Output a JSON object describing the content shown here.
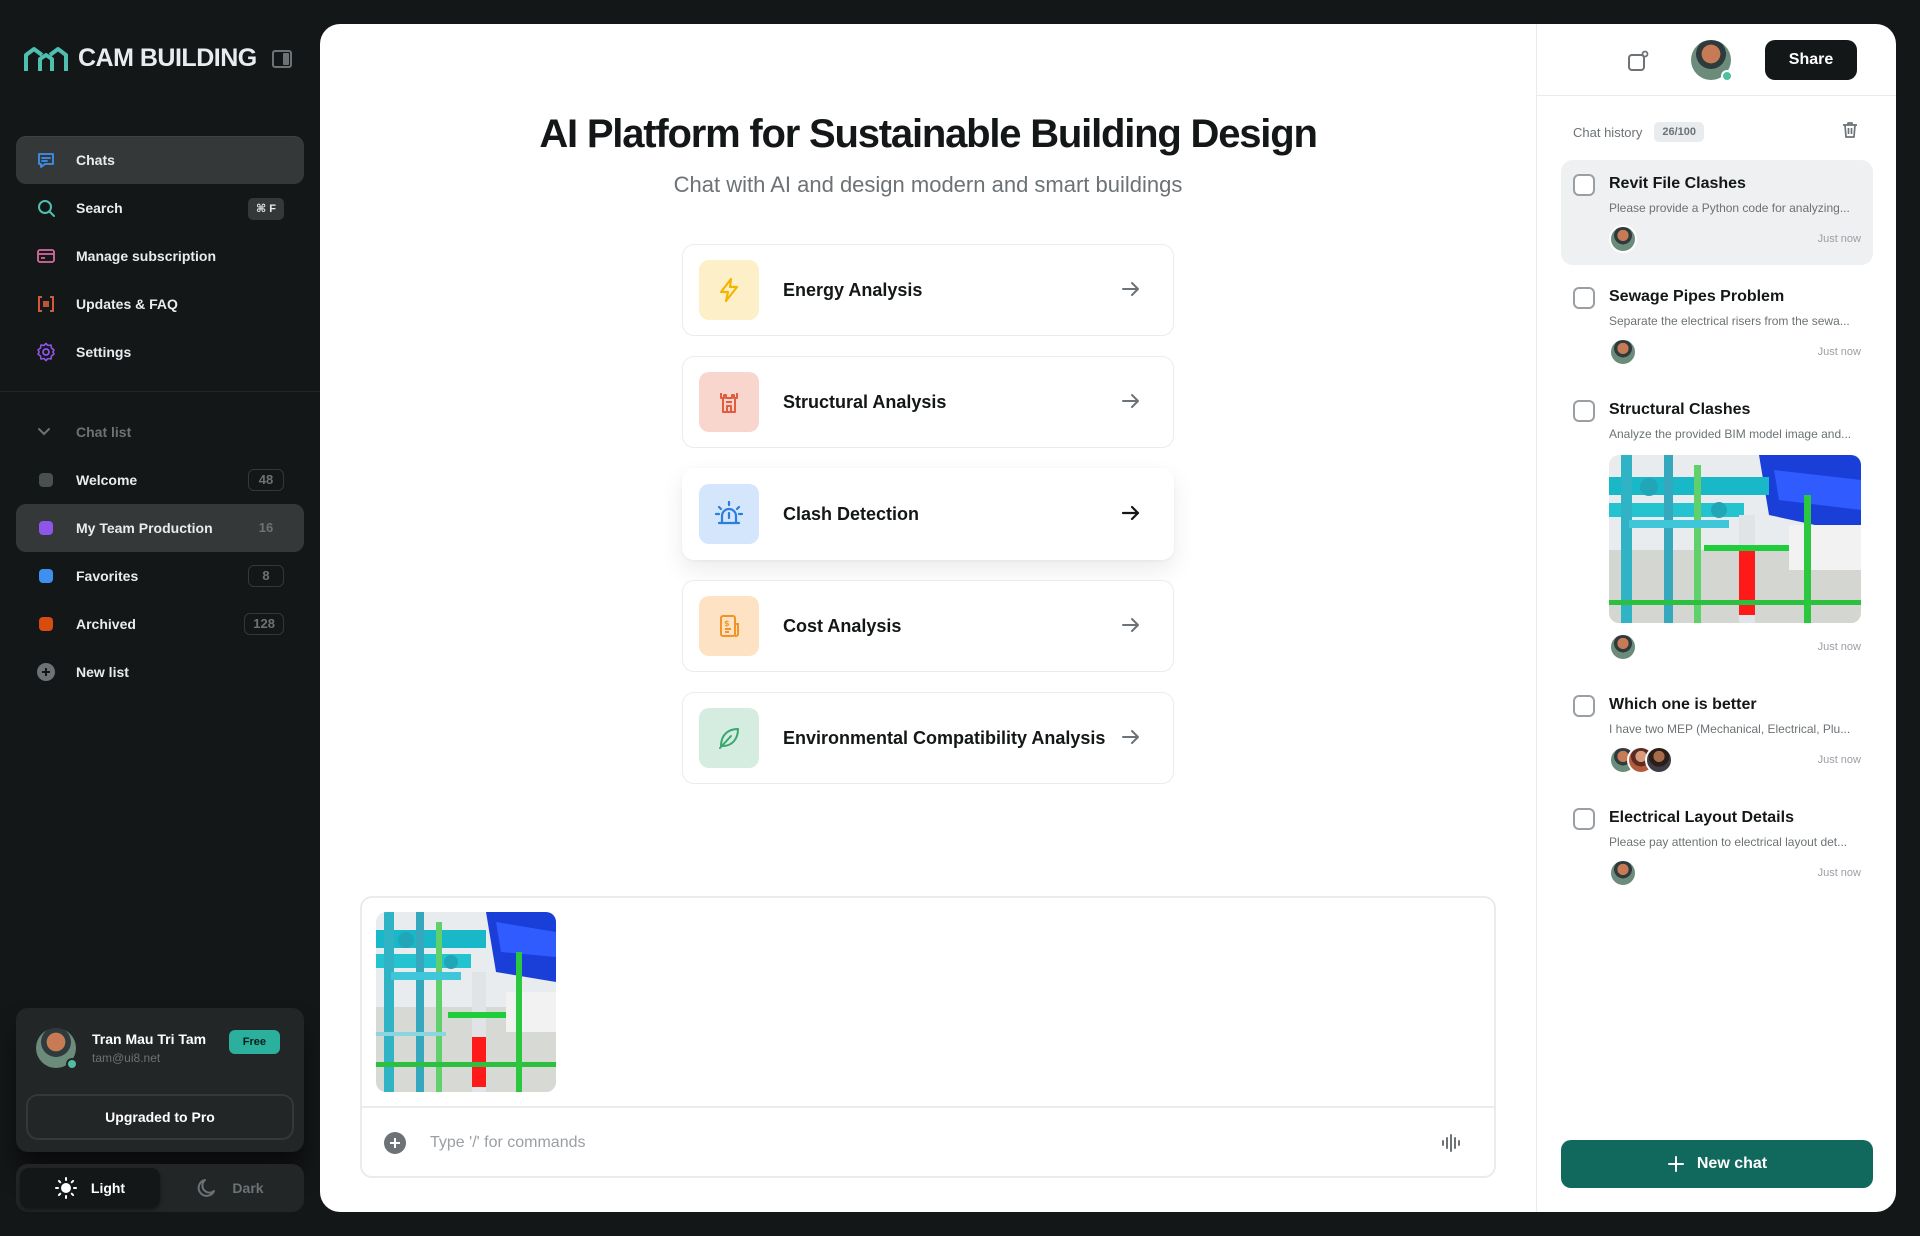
{
  "brand": {
    "name": "CAM BUILDING",
    "logo_icon": "cam-logo-icon"
  },
  "sidebar": {
    "nav": [
      {
        "label": "Chats",
        "icon": "chat-bubble-icon",
        "active": true
      },
      {
        "label": "Search",
        "icon": "search-icon",
        "shortcut": "⌘ F"
      },
      {
        "label": "Manage subscription",
        "icon": "card-icon"
      },
      {
        "label": "Updates & FAQ",
        "icon": "bracket-icon"
      },
      {
        "label": "Settings",
        "icon": "gear-icon"
      }
    ],
    "list_header": "Chat list",
    "lists": [
      {
        "label": "Welcome",
        "count": "48",
        "color": "#4a4f52"
      },
      {
        "label": "My Team Production",
        "count": "16",
        "color": "#8e55ea",
        "active": true
      },
      {
        "label": "Favorites",
        "count": "8",
        "color": "#3e90f0"
      },
      {
        "label": "Archived",
        "count": "128",
        "color": "#d84c10"
      }
    ],
    "new_list": "New list",
    "user": {
      "name": "Tran Mau Tri Tam",
      "email": "tam@ui8.net",
      "plan": "Free",
      "upgrade": "Upgraded to Pro"
    },
    "theme": {
      "light": "Light",
      "dark": "Dark",
      "selected": "light"
    }
  },
  "main": {
    "title": "AI Platform for Sustainable Building Design",
    "subtitle": "Chat with AI and design modern and smart buildings",
    "cards": [
      {
        "label": "Energy Analysis",
        "icon": "lightning-icon",
        "bg": "#fdf0c9",
        "fg": "#f4b400"
      },
      {
        "label": "Structural Analysis",
        "icon": "tower-icon",
        "bg": "#f8d6cd",
        "fg": "#e25c3f"
      },
      {
        "label": "Clash Detection",
        "icon": "alarm-icon",
        "bg": "#d4e6fb",
        "fg": "#2b7de0"
      },
      {
        "label": "Cost Analysis",
        "icon": "invoice-icon",
        "bg": "#fde3c4",
        "fg": "#f0942a"
      },
      {
        "label": "Environmental Compatibility Analysis",
        "icon": "leaf-icon",
        "bg": "#d5ede0",
        "fg": "#3aa66f"
      }
    ],
    "composer": {
      "placeholder": "Type '/' for commands"
    }
  },
  "right": {
    "share": "Share",
    "history_label": "Chat history",
    "history_count": "26/100",
    "items": [
      {
        "title": "Revit File Clashes",
        "desc": "Please provide a Python code for analyzing...",
        "time": "Just now",
        "active": true
      },
      {
        "title": "Sewage Pipes Problem",
        "desc": "Separate the electrical risers from the sewa...",
        "time": "Just now"
      },
      {
        "title": "Structural Clashes",
        "desc": "Analyze the provided BIM model image and...",
        "time": "Just now",
        "image": true
      },
      {
        "title": "Which one is better",
        "desc": "I have two MEP (Mechanical, Electrical, Plu...",
        "time": "Just now",
        "multi": true
      },
      {
        "title": "Electrical Layout Details",
        "desc": "Please pay attention to electrical layout det...",
        "time": "Just now"
      }
    ],
    "new_chat": "New chat"
  }
}
